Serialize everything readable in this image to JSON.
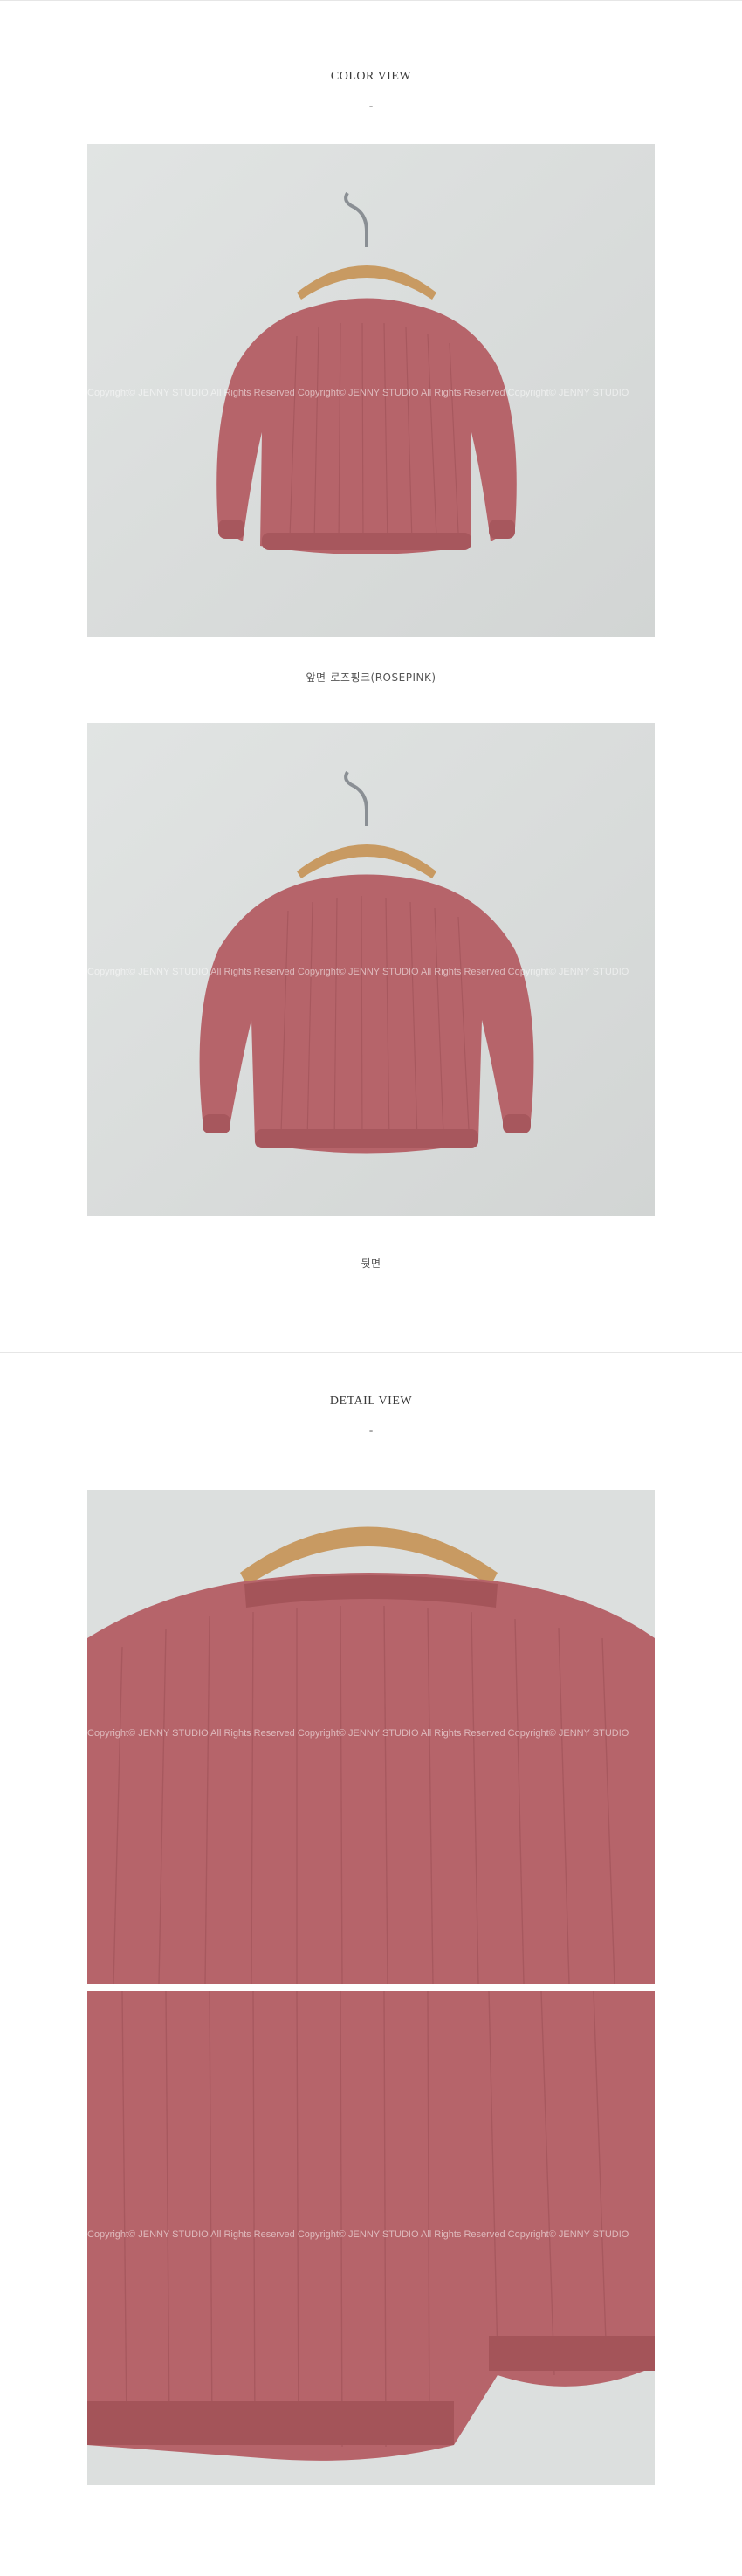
{
  "color_view": {
    "title": "COLOR VIEW",
    "dash": "-",
    "photos": [
      {
        "caption": "앞면-로즈핑크(ROSEPINK)",
        "watermark": "Copyright© JENNY STUDIO All Rights Reserved  Copyright© JENNY STUDIO All Rights Reserved  Copyright© JENNY STUDIO"
      },
      {
        "caption": "뒷면",
        "watermark": "Copyright© JENNY STUDIO All Rights Reserved  Copyright© JENNY STUDIO All Rights Reserved  Copyright© JENNY STUDIO"
      }
    ]
  },
  "detail_view": {
    "title": "DETAIL VIEW",
    "dash": "-",
    "photos": [
      {
        "watermark": "Copyright© JENNY STUDIO All Rights Reserved  Copyright© JENNY STUDIO All Rights Reserved  Copyright© JENNY STUDIO"
      },
      {
        "watermark": "Copyright© JENNY STUDIO All Rights Reserved  Copyright© JENNY STUDIO All Rights Reserved  Copyright© JENNY STUDIO"
      }
    ]
  },
  "colors": {
    "background": "#d9dcdb",
    "garment": "#b6646a",
    "hanger_wood": "#c89a62",
    "hanger_metal": "#8a8f94"
  }
}
